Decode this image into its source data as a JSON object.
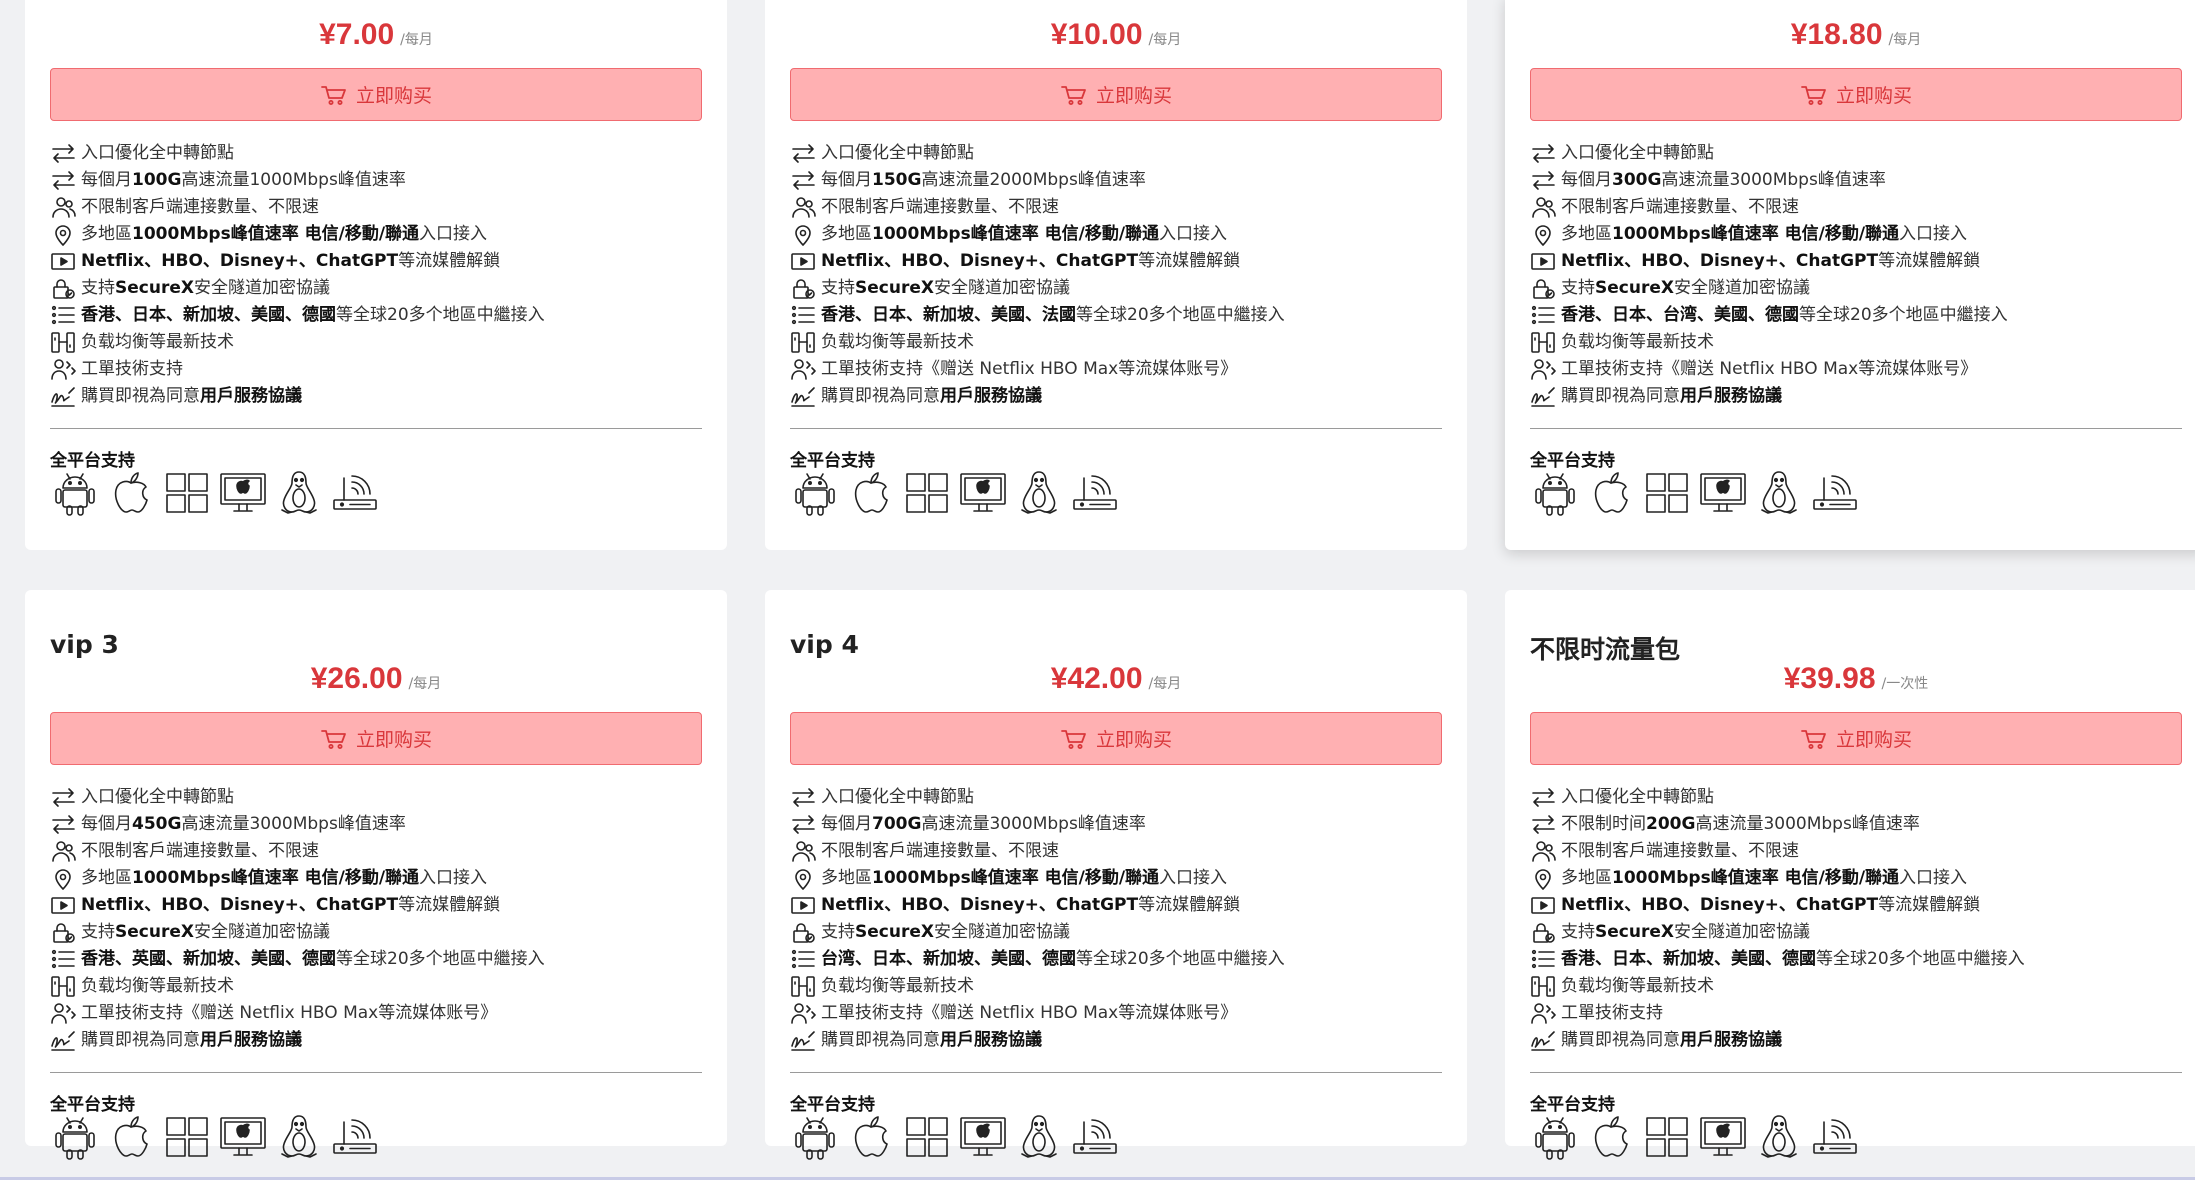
{
  "buy_label": "立即购买",
  "platforms_label": "全平台支持",
  "platform_icons": [
    "android-icon",
    "apple-icon",
    "windows-icon",
    "macos-icon",
    "linux-icon",
    "router-icon"
  ],
  "colors": {
    "price": "#d9373b",
    "button_bg": "#ffb0b2",
    "button_border": "#f06b70"
  },
  "cards": [
    {
      "title": "",
      "price": "¥7.00",
      "period": "/每月",
      "features": [
        {
          "icon": "swap-arrows-icon",
          "parts": [
            {
              "t": "入口優化全中轉節點",
              "b": false
            }
          ]
        },
        {
          "icon": "swap-arrows-icon",
          "parts": [
            {
              "t": "每個月",
              "b": false
            },
            {
              "t": "100G",
              "b": true
            },
            {
              "t": "高速流量1000Mbps峰值速率",
              "b": false
            }
          ]
        },
        {
          "icon": "users-icon",
          "parts": [
            {
              "t": "不限制客戶端連接數量、不限速",
              "b": false
            }
          ]
        },
        {
          "icon": "location-pin-icon",
          "parts": [
            {
              "t": "多地區",
              "b": false
            },
            {
              "t": "1000Mbps峰值速率 电信/移動/聯通",
              "b": true
            },
            {
              "t": "入口接入",
              "b": false
            }
          ]
        },
        {
          "icon": "play-icon",
          "parts": [
            {
              "t": "Netflix、HBO、Disney+、ChatGPT",
              "b": true
            },
            {
              "t": "等流媒體解鎖",
              "b": false
            }
          ]
        },
        {
          "icon": "lock-icon",
          "parts": [
            {
              "t": "支持",
              "b": false
            },
            {
              "t": "SecureX",
              "b": true
            },
            {
              "t": "安全隧道加密協議",
              "b": false
            }
          ]
        },
        {
          "icon": "list-icon",
          "parts": [
            {
              "t": "香港、日本、新加坡、美國、德國",
              "b": true
            },
            {
              "t": "等全球20多个地區中繼接入",
              "b": false
            }
          ]
        },
        {
          "icon": "balance-icon",
          "parts": [
            {
              "t": "负载均衡等最新技术",
              "b": false
            }
          ]
        },
        {
          "icon": "support-icon",
          "parts": [
            {
              "t": "工單技術支持",
              "b": false
            }
          ]
        },
        {
          "icon": "signature-icon",
          "parts": [
            {
              "t": "購買即視為同意",
              "b": false
            },
            {
              "t": "用戶服務協議",
              "b": true
            }
          ]
        }
      ]
    },
    {
      "title": "",
      "price": "¥10.00",
      "period": "/每月",
      "features": [
        {
          "icon": "swap-arrows-icon",
          "parts": [
            {
              "t": "入口優化全中轉節點",
              "b": false
            }
          ]
        },
        {
          "icon": "swap-arrows-icon",
          "parts": [
            {
              "t": "每個月",
              "b": false
            },
            {
              "t": "150G",
              "b": true
            },
            {
              "t": "高速流量2000Mbps峰值速率",
              "b": false
            }
          ]
        },
        {
          "icon": "users-icon",
          "parts": [
            {
              "t": "不限制客戶端連接數量、不限速",
              "b": false
            }
          ]
        },
        {
          "icon": "location-pin-icon",
          "parts": [
            {
              "t": "多地區",
              "b": false
            },
            {
              "t": "1000Mbps峰值速率 电信/移動/聯通",
              "b": true
            },
            {
              "t": "入口接入",
              "b": false
            }
          ]
        },
        {
          "icon": "play-icon",
          "parts": [
            {
              "t": "Netflix、HBO、Disney+、ChatGPT",
              "b": true
            },
            {
              "t": "等流媒體解鎖",
              "b": false
            }
          ]
        },
        {
          "icon": "lock-icon",
          "parts": [
            {
              "t": "支持",
              "b": false
            },
            {
              "t": "SecureX",
              "b": true
            },
            {
              "t": "安全隧道加密協議",
              "b": false
            }
          ]
        },
        {
          "icon": "list-icon",
          "parts": [
            {
              "t": "香港、日本、新加坡、美國、法國",
              "b": true
            },
            {
              "t": "等全球20多个地區中繼接入",
              "b": false
            }
          ]
        },
        {
          "icon": "balance-icon",
          "parts": [
            {
              "t": "负载均衡等最新技术",
              "b": false
            }
          ]
        },
        {
          "icon": "support-icon",
          "parts": [
            {
              "t": "工單技術支持《赠送 Netflix HBO Max等流媒体账号》",
              "b": false
            }
          ]
        },
        {
          "icon": "signature-icon",
          "parts": [
            {
              "t": "購買即視為同意",
              "b": false
            },
            {
              "t": "用戶服務協議",
              "b": true
            }
          ]
        }
      ]
    },
    {
      "title": "",
      "price": "¥18.80",
      "period": "/每月",
      "features": [
        {
          "icon": "swap-arrows-icon",
          "parts": [
            {
              "t": "入口優化全中轉節點",
              "b": false
            }
          ]
        },
        {
          "icon": "swap-arrows-icon",
          "parts": [
            {
              "t": "每個月",
              "b": false
            },
            {
              "t": "300G",
              "b": true
            },
            {
              "t": "高速流量3000Mbps峰值速率",
              "b": false
            }
          ]
        },
        {
          "icon": "users-icon",
          "parts": [
            {
              "t": "不限制客戶端連接數量、不限速",
              "b": false
            }
          ]
        },
        {
          "icon": "location-pin-icon",
          "parts": [
            {
              "t": "多地區",
              "b": false
            },
            {
              "t": "1000Mbps峰值速率 电信/移動/聯通",
              "b": true
            },
            {
              "t": "入口接入",
              "b": false
            }
          ]
        },
        {
          "icon": "play-icon",
          "parts": [
            {
              "t": "Netflix、HBO、Disney+、ChatGPT",
              "b": true
            },
            {
              "t": "等流媒體解鎖",
              "b": false
            }
          ]
        },
        {
          "icon": "lock-icon",
          "parts": [
            {
              "t": "支持",
              "b": false
            },
            {
              "t": "SecureX",
              "b": true
            },
            {
              "t": "安全隧道加密協議",
              "b": false
            }
          ]
        },
        {
          "icon": "list-icon",
          "parts": [
            {
              "t": "香港、日本、台湾、美國、德國",
              "b": true
            },
            {
              "t": "等全球20多个地區中繼接入",
              "b": false
            }
          ]
        },
        {
          "icon": "balance-icon",
          "parts": [
            {
              "t": "负载均衡等最新技术",
              "b": false
            }
          ]
        },
        {
          "icon": "support-icon",
          "parts": [
            {
              "t": "工單技術支持《赠送 Netflix HBO Max等流媒体账号》",
              "b": false
            }
          ]
        },
        {
          "icon": "signature-icon",
          "parts": [
            {
              "t": "購買即視為同意",
              "b": false
            },
            {
              "t": "用戶服務協議",
              "b": true
            }
          ]
        }
      ]
    },
    {
      "title": "vip 3",
      "price": "¥26.00",
      "period": "/每月",
      "features": [
        {
          "icon": "swap-arrows-icon",
          "parts": [
            {
              "t": "入口優化全中轉節點",
              "b": false
            }
          ]
        },
        {
          "icon": "swap-arrows-icon",
          "parts": [
            {
              "t": "每個月",
              "b": false
            },
            {
              "t": "450G",
              "b": true
            },
            {
              "t": "高速流量3000Mbps峰值速率",
              "b": false
            }
          ]
        },
        {
          "icon": "users-icon",
          "parts": [
            {
              "t": "不限制客戶端連接數量、不限速",
              "b": false
            }
          ]
        },
        {
          "icon": "location-pin-icon",
          "parts": [
            {
              "t": "多地區",
              "b": false
            },
            {
              "t": "1000Mbps峰值速率 电信/移動/聯通",
              "b": true
            },
            {
              "t": "入口接入",
              "b": false
            }
          ]
        },
        {
          "icon": "play-icon",
          "parts": [
            {
              "t": "Netflix、HBO、Disney+、ChatGPT",
              "b": true
            },
            {
              "t": "等流媒體解鎖",
              "b": false
            }
          ]
        },
        {
          "icon": "lock-icon",
          "parts": [
            {
              "t": "支持",
              "b": false
            },
            {
              "t": "SecureX",
              "b": true
            },
            {
              "t": "安全隧道加密協議",
              "b": false
            }
          ]
        },
        {
          "icon": "list-icon",
          "parts": [
            {
              "t": "香港、英國、新加坡、美國、德國",
              "b": true
            },
            {
              "t": "等全球20多个地區中繼接入",
              "b": false
            }
          ]
        },
        {
          "icon": "balance-icon",
          "parts": [
            {
              "t": "负载均衡等最新技术",
              "b": false
            }
          ]
        },
        {
          "icon": "support-icon",
          "parts": [
            {
              "t": "工單技術支持《赠送 Netflix HBO Max等流媒体账号》",
              "b": false
            }
          ]
        },
        {
          "icon": "signature-icon",
          "parts": [
            {
              "t": "購買即視為同意",
              "b": false
            },
            {
              "t": "用戶服務協議",
              "b": true
            }
          ]
        }
      ]
    },
    {
      "title": "vip 4",
      "price": "¥42.00",
      "period": "/每月",
      "features": [
        {
          "icon": "swap-arrows-icon",
          "parts": [
            {
              "t": "入口優化全中轉節點",
              "b": false
            }
          ]
        },
        {
          "icon": "swap-arrows-icon",
          "parts": [
            {
              "t": "每個月",
              "b": false
            },
            {
              "t": "700G",
              "b": true
            },
            {
              "t": "高速流量3000Mbps峰值速率",
              "b": false
            }
          ]
        },
        {
          "icon": "users-icon",
          "parts": [
            {
              "t": "不限制客戶端連接數量、不限速",
              "b": false
            }
          ]
        },
        {
          "icon": "location-pin-icon",
          "parts": [
            {
              "t": "多地區",
              "b": false
            },
            {
              "t": "1000Mbps峰值速率 电信/移動/聯通",
              "b": true
            },
            {
              "t": "入口接入",
              "b": false
            }
          ]
        },
        {
          "icon": "play-icon",
          "parts": [
            {
              "t": "Netflix、HBO、Disney+、ChatGPT",
              "b": true
            },
            {
              "t": "等流媒體解鎖",
              "b": false
            }
          ]
        },
        {
          "icon": "lock-icon",
          "parts": [
            {
              "t": "支持",
              "b": false
            },
            {
              "t": "SecureX",
              "b": true
            },
            {
              "t": "安全隧道加密協議",
              "b": false
            }
          ]
        },
        {
          "icon": "list-icon",
          "parts": [
            {
              "t": "台湾、日本、新加坡、美國、德國",
              "b": true
            },
            {
              "t": "等全球20多个地區中繼接入",
              "b": false
            }
          ]
        },
        {
          "icon": "balance-icon",
          "parts": [
            {
              "t": "负载均衡等最新技术",
              "b": false
            }
          ]
        },
        {
          "icon": "support-icon",
          "parts": [
            {
              "t": "工單技術支持《赠送 Netflix HBO Max等流媒体账号》",
              "b": false
            }
          ]
        },
        {
          "icon": "signature-icon",
          "parts": [
            {
              "t": "購買即視為同意",
              "b": false
            },
            {
              "t": "用戶服務協議",
              "b": true
            }
          ]
        }
      ]
    },
    {
      "title": "不限时流量包",
      "price": "¥39.98",
      "period": "/一次性",
      "features": [
        {
          "icon": "swap-arrows-icon",
          "parts": [
            {
              "t": "入口優化全中轉節點",
              "b": false
            }
          ]
        },
        {
          "icon": "swap-arrows-icon",
          "parts": [
            {
              "t": "不限制时间",
              "b": false
            },
            {
              "t": "200G",
              "b": true
            },
            {
              "t": "高速流量3000Mbps峰值速率",
              "b": false
            }
          ]
        },
        {
          "icon": "users-icon",
          "parts": [
            {
              "t": "不限制客戶端連接數量、不限速",
              "b": false
            }
          ]
        },
        {
          "icon": "location-pin-icon",
          "parts": [
            {
              "t": "多地區",
              "b": false
            },
            {
              "t": "1000Mbps峰值速率 电信/移動/聯通",
              "b": true
            },
            {
              "t": "入口接入",
              "b": false
            }
          ]
        },
        {
          "icon": "play-icon",
          "parts": [
            {
              "t": "Netflix、HBO、Disney+、ChatGPT",
              "b": true
            },
            {
              "t": "等流媒體解鎖",
              "b": false
            }
          ]
        },
        {
          "icon": "lock-icon",
          "parts": [
            {
              "t": "支持",
              "b": false
            },
            {
              "t": "SecureX",
              "b": true
            },
            {
              "t": "安全隧道加密協議",
              "b": false
            }
          ]
        },
        {
          "icon": "list-icon",
          "parts": [
            {
              "t": "香港、日本、新加坡、美國、德國",
              "b": true
            },
            {
              "t": "等全球20多个地區中繼接入",
              "b": false
            }
          ]
        },
        {
          "icon": "balance-icon",
          "parts": [
            {
              "t": "负载均衡等最新技术",
              "b": false
            }
          ]
        },
        {
          "icon": "support-icon",
          "parts": [
            {
              "t": "工單技術支持",
              "b": false
            }
          ]
        },
        {
          "icon": "signature-icon",
          "parts": [
            {
              "t": "購買即視為同意",
              "b": false
            },
            {
              "t": "用戶服務協議",
              "b": true
            }
          ]
        }
      ]
    }
  ]
}
